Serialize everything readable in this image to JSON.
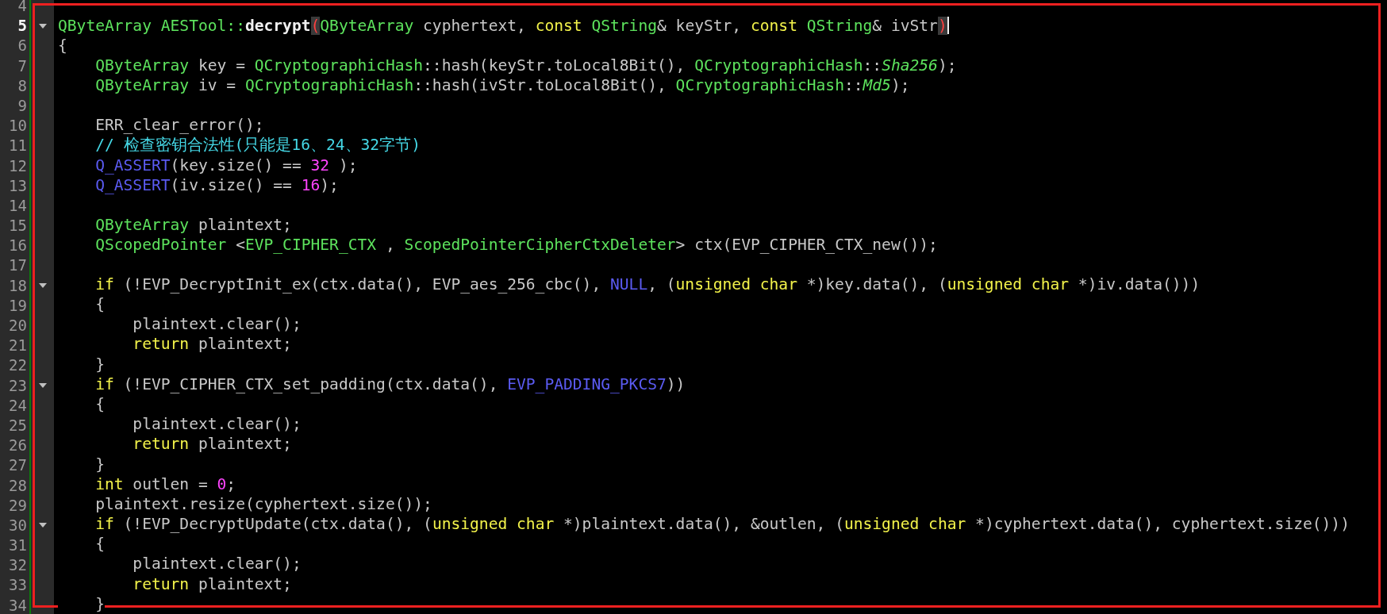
{
  "lines": [
    {
      "number": "4",
      "fold": false,
      "current": false,
      "caret": false
    },
    {
      "number": "5",
      "fold": true,
      "current": true,
      "caret": true,
      "tokens": [
        {
          "t": "QByteArray",
          "kind": "type"
        },
        {
          "t": " AESTool::",
          "kind": "type"
        },
        {
          "t": "decrypt",
          "kind": "func"
        },
        {
          "t": "(",
          "kind": "match"
        },
        {
          "t": "QByteArray",
          "kind": "type"
        },
        {
          "t": " cyphertext, ",
          "kind": "plain"
        },
        {
          "t": "const",
          "kind": "keyword"
        },
        {
          "t": " QString",
          "kind": "type"
        },
        {
          "t": "& keyStr, ",
          "kind": "plain"
        },
        {
          "t": "const",
          "kind": "keyword"
        },
        {
          "t": " QString",
          "kind": "type"
        },
        {
          "t": "& ivStr",
          "kind": "plain"
        },
        {
          "t": ")",
          "kind": "match"
        }
      ]
    },
    {
      "number": "6",
      "fold": false,
      "current": false,
      "caret": false,
      "tokens": [
        {
          "t": "{",
          "kind": "plain"
        }
      ]
    },
    {
      "number": "7",
      "fold": false,
      "current": false,
      "caret": false,
      "tokens": [
        {
          "t": "    QByteArray",
          "kind": "type"
        },
        {
          "t": " key = ",
          "kind": "plain"
        },
        {
          "t": "QCryptographicHash",
          "kind": "type"
        },
        {
          "t": "::hash(keyStr.toLocal8Bit(), ",
          "kind": "plain"
        },
        {
          "t": "QCryptographicHash",
          "kind": "type"
        },
        {
          "t": "::",
          "kind": "plain"
        },
        {
          "t": "Sha256",
          "kind": "enum"
        },
        {
          "t": ");",
          "kind": "plain"
        }
      ]
    },
    {
      "number": "8",
      "fold": false,
      "current": false,
      "caret": false,
      "tokens": [
        {
          "t": "    QByteArray",
          "kind": "type"
        },
        {
          "t": " iv = ",
          "kind": "plain"
        },
        {
          "t": "QCryptographicHash",
          "kind": "type"
        },
        {
          "t": "::hash(ivStr.toLocal8Bit(), ",
          "kind": "plain"
        },
        {
          "t": "QCryptographicHash",
          "kind": "type"
        },
        {
          "t": "::",
          "kind": "plain"
        },
        {
          "t": "Md5",
          "kind": "enum"
        },
        {
          "t": ");",
          "kind": "plain"
        }
      ]
    },
    {
      "number": "9",
      "fold": false,
      "current": false,
      "caret": false
    },
    {
      "number": "10",
      "fold": false,
      "current": false,
      "caret": false,
      "tokens": [
        {
          "t": "    ERR_clear_error();",
          "kind": "plain"
        }
      ]
    },
    {
      "number": "11",
      "fold": false,
      "current": false,
      "caret": false,
      "tokens": [
        {
          "t": "    // 检查密钥合法性(只能是16、24、32字节)",
          "kind": "comment"
        }
      ]
    },
    {
      "number": "12",
      "fold": false,
      "current": false,
      "caret": false,
      "tokens": [
        {
          "t": "    Q_ASSERT",
          "kind": "macro"
        },
        {
          "t": "(key.size() == ",
          "kind": "plain"
        },
        {
          "t": "32",
          "kind": "number"
        },
        {
          "t": " );",
          "kind": "plain"
        }
      ]
    },
    {
      "number": "13",
      "fold": false,
      "current": false,
      "caret": false,
      "tokens": [
        {
          "t": "    Q_ASSERT",
          "kind": "macro"
        },
        {
          "t": "(iv.size() == ",
          "kind": "plain"
        },
        {
          "t": "16",
          "kind": "number"
        },
        {
          "t": ");",
          "kind": "plain"
        }
      ]
    },
    {
      "number": "14",
      "fold": false,
      "current": false,
      "caret": false
    },
    {
      "number": "15",
      "fold": false,
      "current": false,
      "caret": false,
      "tokens": [
        {
          "t": "    QByteArray",
          "kind": "type"
        },
        {
          "t": " plaintext;",
          "kind": "plain"
        }
      ]
    },
    {
      "number": "16",
      "fold": false,
      "current": false,
      "caret": false,
      "tokens": [
        {
          "t": "    QScopedPointer",
          "kind": "type"
        },
        {
          "t": " <",
          "kind": "plain"
        },
        {
          "t": "EVP_CIPHER_CTX",
          "kind": "type"
        },
        {
          "t": " , ",
          "kind": "plain"
        },
        {
          "t": "ScopedPointerCipherCtxDeleter",
          "kind": "type"
        },
        {
          "t": "> ctx(EVP_CIPHER_CTX_new());",
          "kind": "plain"
        }
      ]
    },
    {
      "number": "17",
      "fold": false,
      "current": false,
      "caret": false
    },
    {
      "number": "18",
      "fold": true,
      "current": false,
      "caret": false,
      "tokens": [
        {
          "t": "    if",
          "kind": "keyword"
        },
        {
          "t": " (!EVP_DecryptInit_ex(ctx.data(), EVP_aes_256_cbc(), ",
          "kind": "plain"
        },
        {
          "t": "NULL",
          "kind": "macro"
        },
        {
          "t": ", (",
          "kind": "plain"
        },
        {
          "t": "unsigned char",
          "kind": "keyword"
        },
        {
          "t": " *)key.data(), (",
          "kind": "plain"
        },
        {
          "t": "unsigned char",
          "kind": "keyword"
        },
        {
          "t": " *)iv.data()))",
          "kind": "plain"
        }
      ]
    },
    {
      "number": "19",
      "fold": false,
      "current": false,
      "caret": false,
      "tokens": [
        {
          "t": "    {",
          "kind": "plain"
        }
      ]
    },
    {
      "number": "20",
      "fold": false,
      "current": false,
      "caret": false,
      "tokens": [
        {
          "t": "        plaintext.clear();",
          "kind": "plain"
        }
      ]
    },
    {
      "number": "21",
      "fold": false,
      "current": false,
      "caret": false,
      "tokens": [
        {
          "t": "        return",
          "kind": "keyword"
        },
        {
          "t": " plaintext;",
          "kind": "plain"
        }
      ]
    },
    {
      "number": "22",
      "fold": false,
      "current": false,
      "caret": false,
      "tokens": [
        {
          "t": "    }",
          "kind": "plain"
        }
      ]
    },
    {
      "number": "23",
      "fold": true,
      "current": false,
      "caret": false,
      "tokens": [
        {
          "t": "    if",
          "kind": "keyword"
        },
        {
          "t": " (!EVP_CIPHER_CTX_set_padding(ctx.data(), ",
          "kind": "plain"
        },
        {
          "t": "EVP_PADDING_PKCS7",
          "kind": "macro"
        },
        {
          "t": "))",
          "kind": "plain"
        }
      ]
    },
    {
      "number": "24",
      "fold": false,
      "current": false,
      "caret": false,
      "tokens": [
        {
          "t": "    {",
          "kind": "plain"
        }
      ]
    },
    {
      "number": "25",
      "fold": false,
      "current": false,
      "caret": false,
      "tokens": [
        {
          "t": "        plaintext.clear();",
          "kind": "plain"
        }
      ]
    },
    {
      "number": "26",
      "fold": false,
      "current": false,
      "caret": false,
      "tokens": [
        {
          "t": "        return",
          "kind": "keyword"
        },
        {
          "t": " plaintext;",
          "kind": "plain"
        }
      ]
    },
    {
      "number": "27",
      "fold": false,
      "current": false,
      "caret": false,
      "tokens": [
        {
          "t": "    }",
          "kind": "plain"
        }
      ]
    },
    {
      "number": "28",
      "fold": false,
      "current": false,
      "caret": false,
      "tokens": [
        {
          "t": "    int",
          "kind": "keyword"
        },
        {
          "t": " outlen = ",
          "kind": "plain"
        },
        {
          "t": "0",
          "kind": "number"
        },
        {
          "t": ";",
          "kind": "plain"
        }
      ]
    },
    {
      "number": "29",
      "fold": false,
      "current": false,
      "caret": false,
      "tokens": [
        {
          "t": "    plaintext.resize(cyphertext.size());",
          "kind": "plain"
        }
      ]
    },
    {
      "number": "30",
      "fold": true,
      "current": false,
      "caret": false,
      "tokens": [
        {
          "t": "    if",
          "kind": "keyword"
        },
        {
          "t": " (!EVP_DecryptUpdate(ctx.data(), (",
          "kind": "plain"
        },
        {
          "t": "unsigned char",
          "kind": "keyword"
        },
        {
          "t": " *)plaintext.data(), &outlen, (",
          "kind": "plain"
        },
        {
          "t": "unsigned char",
          "kind": "keyword"
        },
        {
          "t": " *)cyphertext.data(), cyphertext.size()))",
          "kind": "plain"
        }
      ]
    },
    {
      "number": "31",
      "fold": false,
      "current": false,
      "caret": false,
      "tokens": [
        {
          "t": "    {",
          "kind": "plain"
        }
      ]
    },
    {
      "number": "32",
      "fold": false,
      "current": false,
      "caret": false,
      "tokens": [
        {
          "t": "        plaintext.clear();",
          "kind": "plain"
        }
      ]
    },
    {
      "number": "33",
      "fold": false,
      "current": false,
      "caret": false,
      "tokens": [
        {
          "t": "        return",
          "kind": "keyword"
        },
        {
          "t": " plaintext;",
          "kind": "plain"
        }
      ]
    },
    {
      "number": "34",
      "fold": false,
      "current": false,
      "caret": false,
      "tokens": [
        {
          "t": "    }",
          "kind": "plain"
        }
      ]
    }
  ]
}
